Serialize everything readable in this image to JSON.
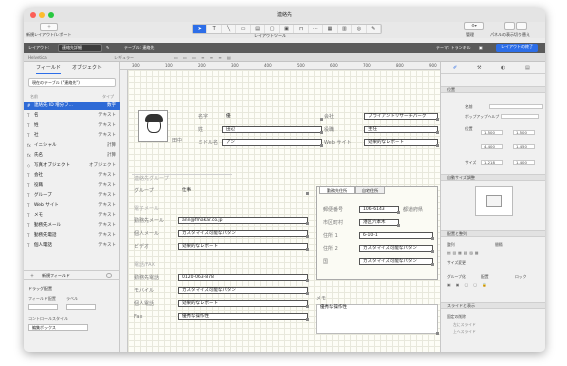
{
  "window": {
    "title": "連絡先"
  },
  "toolbar": {
    "new_layout_label": "新規レイアウト/レポート",
    "layout_tools_label": "レイアウトツール",
    "manage_label": "管理",
    "panel_toggle_label": "パネルの表示切り替え",
    "tool_icons": [
      "pointer-tool",
      "text-tool",
      "line-tool",
      "rect-tool",
      "field-tool",
      "button-tool",
      "popover-tool",
      "tab-tool",
      "slide-tool",
      "portal-tool",
      "chart-tool",
      "webviewer-tool",
      "format-painter-tool"
    ]
  },
  "layoutbar": {
    "layout_label": "レイアウト:",
    "layout_name": "連絡先詳細",
    "table_label": "テーブル: 連絡先",
    "theme_label": "テーマ: トランキル",
    "edit_layout_button": "レイアウトの終了"
  },
  "fmtbar": {
    "left_label": "Helvetica",
    "mid_label": "レギュラー"
  },
  "sidebar": {
    "tab_fields": "フィールド",
    "tab_objects": "オブジェクト",
    "current_table": "現在のテーブル (\"連絡先\")",
    "col_name": "名前",
    "col_type": "タイプ",
    "fields": [
      {
        "icon": "#",
        "name": "連絡先 ID 増分フ...",
        "type": "数字",
        "selected": true
      },
      {
        "icon": "T",
        "name": "名",
        "type": "テキスト"
      },
      {
        "icon": "T",
        "name": "姓",
        "type": "テキスト"
      },
      {
        "icon": "T",
        "name": "社",
        "type": "テキスト"
      },
      {
        "icon": "fx",
        "name": "イニシャル",
        "type": "計算"
      },
      {
        "icon": "fx",
        "name": "氏名",
        "type": "計算"
      },
      {
        "icon": "◇",
        "name": "写真オブジェクト",
        "type": "オブジェクト"
      },
      {
        "icon": "T",
        "name": "会社",
        "type": "テキスト"
      },
      {
        "icon": "T",
        "name": "役職",
        "type": "テキスト"
      },
      {
        "icon": "T",
        "name": "グループ",
        "type": "テキスト"
      },
      {
        "icon": "T",
        "name": "Web サイト",
        "type": "テキスト"
      },
      {
        "icon": "T",
        "name": "メモ",
        "type": "テキスト"
      },
      {
        "icon": "T",
        "name": "勤務先メール",
        "type": "テキスト"
      },
      {
        "icon": "T",
        "name": "勤務先電話",
        "type": "テキスト"
      },
      {
        "icon": "T",
        "name": "個人電話",
        "type": "テキスト"
      }
    ],
    "new_field": "新規フィールド",
    "drag_section": "ドラッグ配置",
    "field_control_label": "フィールド配置",
    "label_label": "ラベル",
    "control_style_label": "コントロールスタイル",
    "control_style_value": "編集ボックス"
  },
  "ruler": {
    "ticks": [
      "300",
      "100",
      "200",
      "300",
      "400",
      "500",
      "600",
      "700",
      "800",
      "900"
    ]
  },
  "canvas": {
    "avatar_initials": "田中",
    "labels": {
      "first": "名字",
      "last": "姓",
      "initial": "ミドル名",
      "company": "会社",
      "title": "役職",
      "website": "Web サイト",
      "group_header": "連絡先グループ",
      "group": "グループ",
      "email_head": "電子メール",
      "work_email": "勤務先メール",
      "personal_email": "個人メール",
      "video": "ビデオ",
      "phone_head": "電話/FAX",
      "work_phone": "勤務先電話",
      "mobile": "モバイル",
      "home_phone": "個人電話",
      "fax": "Fax"
    },
    "values": {
      "first": "優",
      "last": "田辺",
      "kana": "アン",
      "company": "ブライアントリサーチパーク",
      "title": "主任",
      "website": "効果的なレポート",
      "group": "仕事",
      "work_email": "ann@fmakar.co.jp",
      "personal_email": "カスタマイズ可能なパタン",
      "video": "効果的なレポート",
      "work_phone": "0120-063-878",
      "mobile": "カスタマイズ可能なパタン",
      "home_phone": "効果的なレポート",
      "fax": "優秀な操作性"
    },
    "tabs": [
      "勤務先住所",
      "自宅住所"
    ],
    "address": {
      "postal_label": "郵便番号",
      "postal": "106-6143",
      "pref_label": "都道府県",
      "city_label": "市区町村",
      "city": "港区六本木",
      "addr1_label": "住所 1",
      "addr1": "6-10-1",
      "addr2_label": "住所 2",
      "addr2": "カスタマイズ可能なパタン",
      "country_label": "国",
      "country": "カスタマイズ可能なパタン"
    },
    "memo_label": "メモ",
    "memo": "優秀な操作性"
  },
  "inspector": {
    "tabs": [
      "position-icon",
      "style-icon",
      "appearance-icon",
      "data-icon"
    ],
    "section_position": "位置",
    "name_label": "名前",
    "tooltip_label": "ポップアップヘルプ",
    "position_label": "位置",
    "pos_vals": {
      "left": "1.500",
      "top": "1.500",
      "right": "4.400",
      "bottom": "1.450"
    },
    "size_label": "サイズ",
    "size_vals": {
      "w": "1.218",
      "h": "1.400"
    },
    "section_autosize": "自動サイズ調整",
    "section_arrange": "配置と整列",
    "arrange_label": "整列",
    "distribute_label": "間隔",
    "resize_label": "サイズ変更",
    "group_label": "グループ化",
    "front_label": "配置",
    "lock_label": "ロック",
    "section_sliding": "スライドと表示",
    "sliding_label": "固定の削除",
    "slide_left": "左にスライド",
    "slide_up": "上へスライド"
  }
}
